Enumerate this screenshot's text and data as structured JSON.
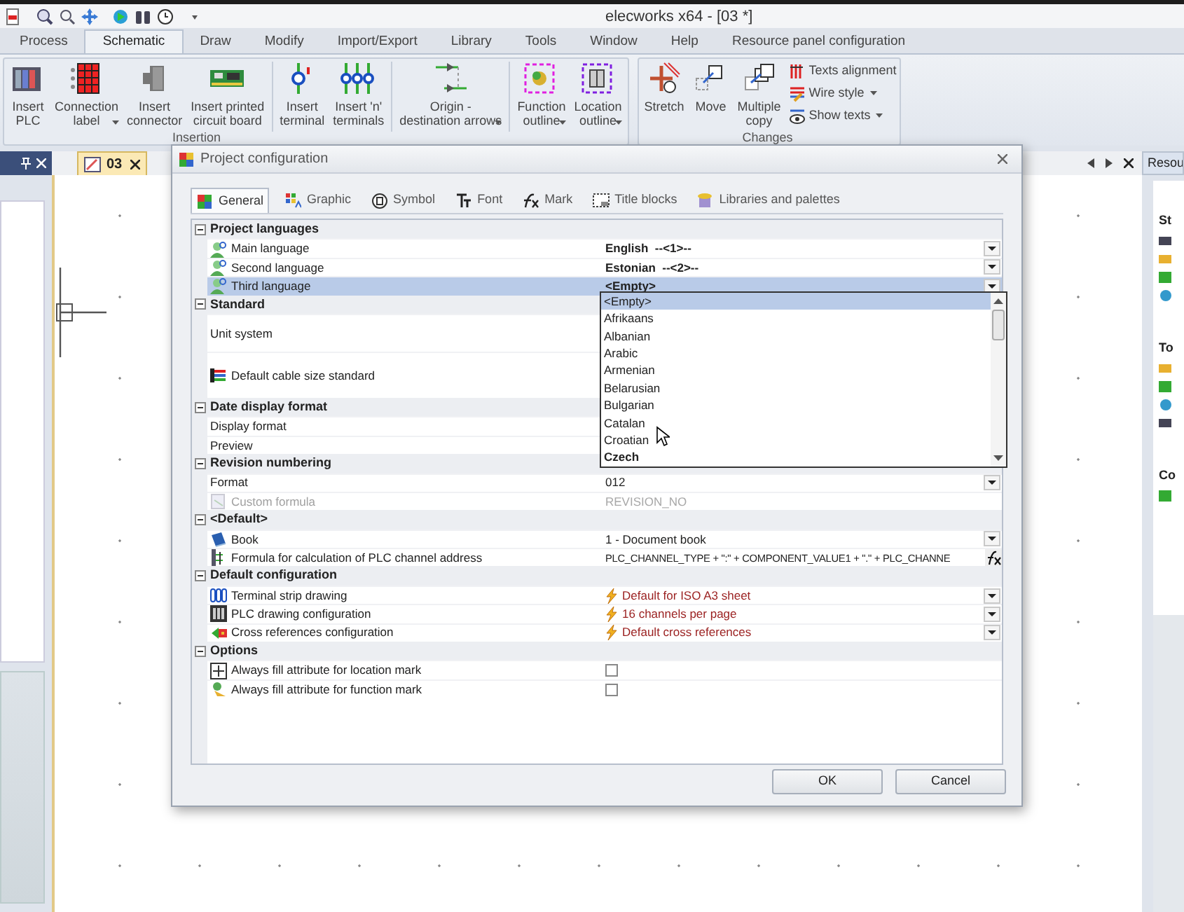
{
  "window": {
    "title": "elecworks x64 - [03 *]"
  },
  "menu_tabs": [
    {
      "label": "Process",
      "selected": false
    },
    {
      "label": "Schematic",
      "selected": true
    },
    {
      "label": "Draw",
      "selected": false
    },
    {
      "label": "Modify",
      "selected": false
    },
    {
      "label": "Import/Export",
      "selected": false
    },
    {
      "label": "Library",
      "selected": false
    },
    {
      "label": "Tools",
      "selected": false
    },
    {
      "label": "Window",
      "selected": false
    },
    {
      "label": "Help",
      "selected": false
    },
    {
      "label": "Resource panel configuration",
      "selected": false
    }
  ],
  "ribbon": {
    "groups": [
      {
        "label": "Insertion",
        "buttons": [
          {
            "label": "Insert\nPLC",
            "kind": "large",
            "has_menu": false
          },
          {
            "label": "Connection\nlabel",
            "kind": "large",
            "has_menu": true
          },
          {
            "label": "Insert\nconnector",
            "kind": "large",
            "has_menu": false
          },
          {
            "label": "Insert printed\ncircuit board",
            "kind": "large",
            "has_menu": false
          },
          {
            "label": "Insert\nterminal",
            "kind": "large",
            "has_menu": false
          },
          {
            "label": "Insert 'n'\nterminals",
            "kind": "large",
            "has_menu": false
          },
          {
            "label": "Origin -\ndestination arrows",
            "kind": "large",
            "has_menu": true
          },
          {
            "label": "Function\noutline",
            "kind": "large",
            "has_menu": true
          },
          {
            "label": "Location\noutline",
            "kind": "large",
            "has_menu": true
          }
        ]
      },
      {
        "label": "Changes",
        "buttons": [
          {
            "label": "Stretch",
            "kind": "large",
            "has_menu": false
          },
          {
            "label": "Move",
            "kind": "large",
            "has_menu": false
          },
          {
            "label": "Multiple\ncopy",
            "kind": "large",
            "has_menu": false
          },
          {
            "label": "Texts alignment",
            "kind": "small",
            "has_menu": false
          },
          {
            "label": "Wire style",
            "kind": "small",
            "has_menu": true
          },
          {
            "label": "Show texts",
            "kind": "small",
            "has_menu": true
          }
        ]
      }
    ]
  },
  "document_tab": {
    "label": "03"
  },
  "side_panel": {
    "title": "Resou",
    "sections": [
      "St",
      "To",
      "Co"
    ]
  },
  "dialog": {
    "title": "Project configuration",
    "tabs": [
      {
        "label": "General",
        "selected": true
      },
      {
        "label": "Graphic",
        "selected": false
      },
      {
        "label": "Symbol",
        "selected": false
      },
      {
        "label": "Font",
        "selected": false
      },
      {
        "label": "Mark",
        "selected": false
      },
      {
        "label": "Title blocks",
        "selected": false
      },
      {
        "label": "Libraries and palettes",
        "selected": false
      }
    ],
    "sections": [
      {
        "title": "Project languages",
        "expanded": true,
        "rows": [
          {
            "label": "Main language",
            "kind": "dropdown",
            "value": "English  --<1>--",
            "bold": true,
            "selected": false,
            "disabled": false
          },
          {
            "label": "Second language",
            "kind": "dropdown",
            "value": "Estonian  --<2>--",
            "bold": true,
            "selected": false,
            "disabled": false
          },
          {
            "label": "Third language",
            "kind": "dropdown",
            "value": "<Empty>",
            "bold": true,
            "selected": true,
            "disabled": false
          }
        ]
      },
      {
        "title": "Standard",
        "expanded": true,
        "rows": [
          {
            "label": "Unit system",
            "kind": "covered",
            "selected": false,
            "disabled": false
          },
          {
            "label": "Default cable size standard",
            "kind": "covered",
            "selected": false,
            "disabled": false
          }
        ]
      },
      {
        "title": "Date display format",
        "expanded": true,
        "rows": [
          {
            "label": "Display format",
            "kind": "covered",
            "selected": false,
            "disabled": false
          },
          {
            "label": "Preview",
            "kind": "covered",
            "selected": false,
            "disabled": false
          }
        ]
      },
      {
        "title": "Revision numbering",
        "expanded": true,
        "rows": [
          {
            "label": "Format",
            "kind": "dropdown",
            "value": "012",
            "bold": false,
            "selected": false,
            "disabled": false
          },
          {
            "label": "Custom formula",
            "kind": "text",
            "value": "REVISION_NO",
            "bold": false,
            "selected": false,
            "disabled": true
          }
        ]
      },
      {
        "title": "<Default>",
        "expanded": true,
        "rows": [
          {
            "label": "Book",
            "kind": "dropdown",
            "value": "1 - Document book",
            "bold": false,
            "selected": false,
            "disabled": false
          },
          {
            "label": "Formula for calculation of PLC channel address",
            "kind": "formula",
            "value": "PLC_CHANNEL_TYPE + \":\" + COMPONENT_VALUE1 + \".\" + PLC_CHANNE",
            "bold": false,
            "selected": false,
            "disabled": false
          }
        ]
      },
      {
        "title": "Default configuration",
        "expanded": true,
        "rows": [
          {
            "label": "Terminal strip drawing",
            "kind": "preset",
            "value": "Default for ISO A3 sheet",
            "bold": false,
            "selected": false,
            "disabled": false
          },
          {
            "label": "PLC drawing configuration",
            "kind": "preset",
            "value": "16 channels per page",
            "bold": false,
            "selected": false,
            "disabled": false
          },
          {
            "label": "Cross references configuration",
            "kind": "preset",
            "value": "Default cross references",
            "bold": false,
            "selected": false,
            "disabled": false
          }
        ]
      },
      {
        "title": "Options",
        "expanded": true,
        "rows": [
          {
            "label": "Always fill attribute for location mark",
            "kind": "checkbox",
            "checked": false,
            "selected": false,
            "disabled": false
          },
          {
            "label": "Always fill attribute for function mark",
            "kind": "checkbox",
            "checked": false,
            "selected": false,
            "disabled": false
          }
        ]
      }
    ],
    "dropdown_list": {
      "items": [
        {
          "label": "<Empty>",
          "selected": true,
          "bold": false
        },
        {
          "label": "Afrikaans",
          "selected": false,
          "bold": false
        },
        {
          "label": "Albanian",
          "selected": false,
          "bold": false
        },
        {
          "label": "Arabic",
          "selected": false,
          "bold": false
        },
        {
          "label": "Armenian",
          "selected": false,
          "bold": false
        },
        {
          "label": "Belarusian",
          "selected": false,
          "bold": false
        },
        {
          "label": "Bulgarian",
          "selected": false,
          "bold": false
        },
        {
          "label": "Catalan",
          "selected": false,
          "bold": false
        },
        {
          "label": "Croatian",
          "selected": false,
          "bold": false
        },
        {
          "label": "Czech",
          "selected": false,
          "bold": true
        }
      ]
    },
    "buttons": [
      "OK",
      "Cancel"
    ]
  }
}
